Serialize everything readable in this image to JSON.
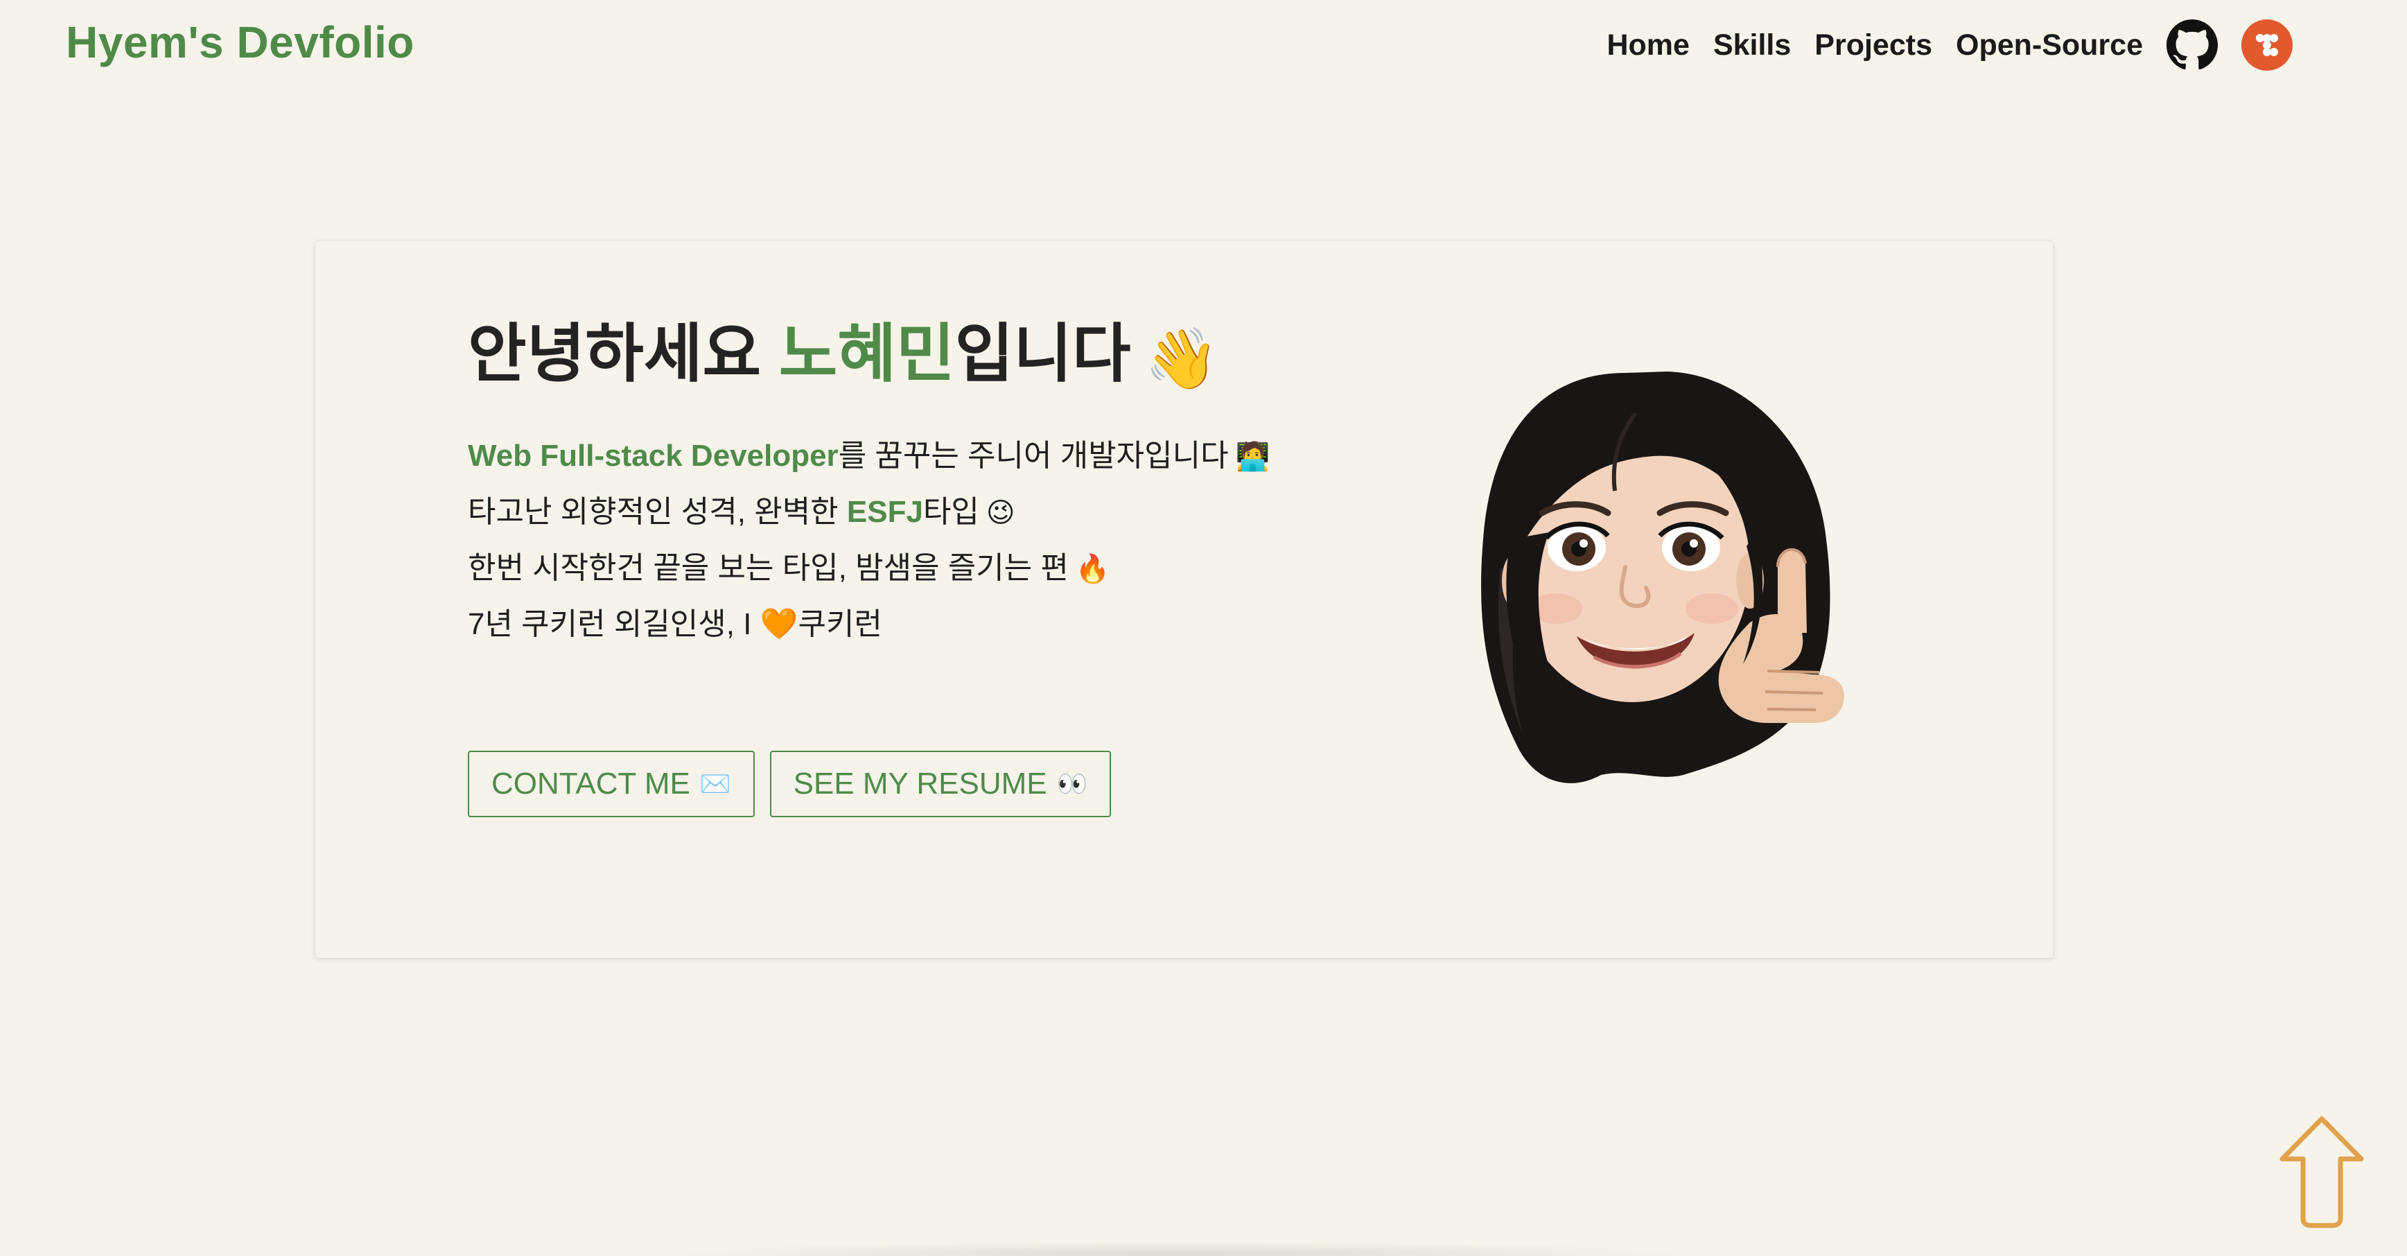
{
  "header": {
    "brand": "Hyem's Devfolio",
    "nav": [
      "Home",
      "Skills",
      "Projects",
      "Open-Source"
    ],
    "icons": [
      "github-icon",
      "tistory-icon"
    ]
  },
  "hero": {
    "greeting_prefix": "안녕하세요 ",
    "greeting_name": "노혜민",
    "greeting_suffix": "입니다",
    "greeting_emoji": "👋",
    "line1_hl": "Web Full-stack Developer",
    "line1_rest": "를 꿈꾸는 주니어 개발자입니다",
    "line1_emoji": "🧑‍💻",
    "line2_pre": "타고난 외향적인 성격, 완벽한 ",
    "line2_hl": "ESFJ",
    "line2_post": "타입",
    "line2_emoji": "😉",
    "line3": "한번 시작한건 끝을 보는 타입, 밤샘을 즐기는 편",
    "line3_emoji": "🔥",
    "line4_pre": "7년 쿠키런 외길인생, I ",
    "line4_heart": "🧡",
    "line4_post": "쿠키런",
    "contact_label": "CONTACT ME",
    "contact_emoji": "✉️",
    "resume_label": "SEE MY RESUME",
    "resume_emoji": "👀"
  },
  "colors": {
    "background": "#f6f3ea",
    "accent_green": "#4f8a49",
    "tistory_orange": "#e2592e",
    "scroll_arrow": "#e0a24c"
  }
}
